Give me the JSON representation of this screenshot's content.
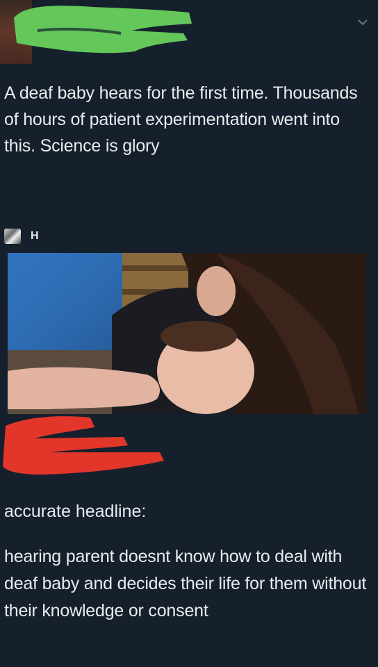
{
  "tweet": {
    "text": "A deaf baby hears for the first time. Thousands of hours of patient experimentation went into this. Science is glory"
  },
  "quoted": {
    "name": "H"
  },
  "reply": {
    "label": "accurate headline:",
    "text": "hearing parent doesnt know how to deal with deaf baby and decides their life for them without their knowledge or consent"
  },
  "icons": {
    "menu": "chevron-down-icon"
  },
  "colors": {
    "background": "#16202c",
    "redact_green": "#63c75a",
    "redact_red": "#e2362b"
  }
}
